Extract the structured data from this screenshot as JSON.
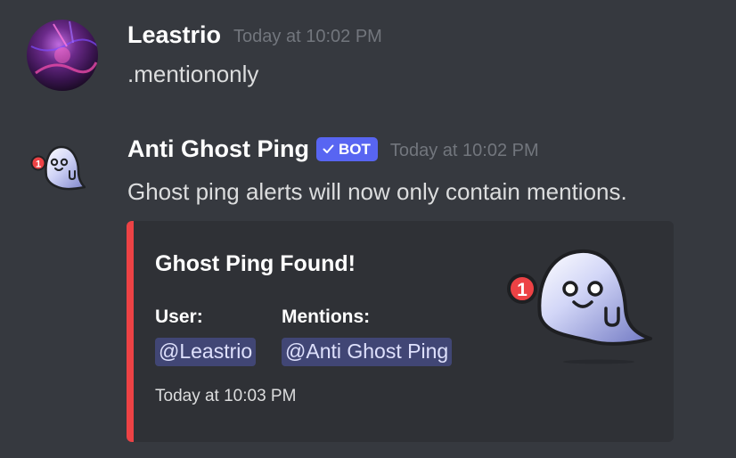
{
  "messages": [
    {
      "author": "Leastrio",
      "timestamp": "Today at 10:02 PM",
      "content": ".mentiononly"
    },
    {
      "author": "Anti Ghost Ping",
      "bot_tag": "BOT",
      "timestamp": "Today at 10:02 PM",
      "content": "Ghost ping alerts will now only contain mentions.",
      "embed": {
        "title": "Ghost Ping Found!",
        "accent_color": "#ed4245",
        "fields": [
          {
            "name": "User:",
            "value": "@Leastrio"
          },
          {
            "name": "Mentions:",
            "value": "@Anti Ghost Ping"
          }
        ],
        "footer": "Today at 10:03 PM",
        "thumbnail_icon": "ghost-icon",
        "badge_count": "1"
      }
    }
  ],
  "colors": {
    "background": "#36393f",
    "embed_background": "#2f3136",
    "bot_tag": "#5865f2",
    "mention_background": "#414675",
    "badge": "#ed4245"
  }
}
